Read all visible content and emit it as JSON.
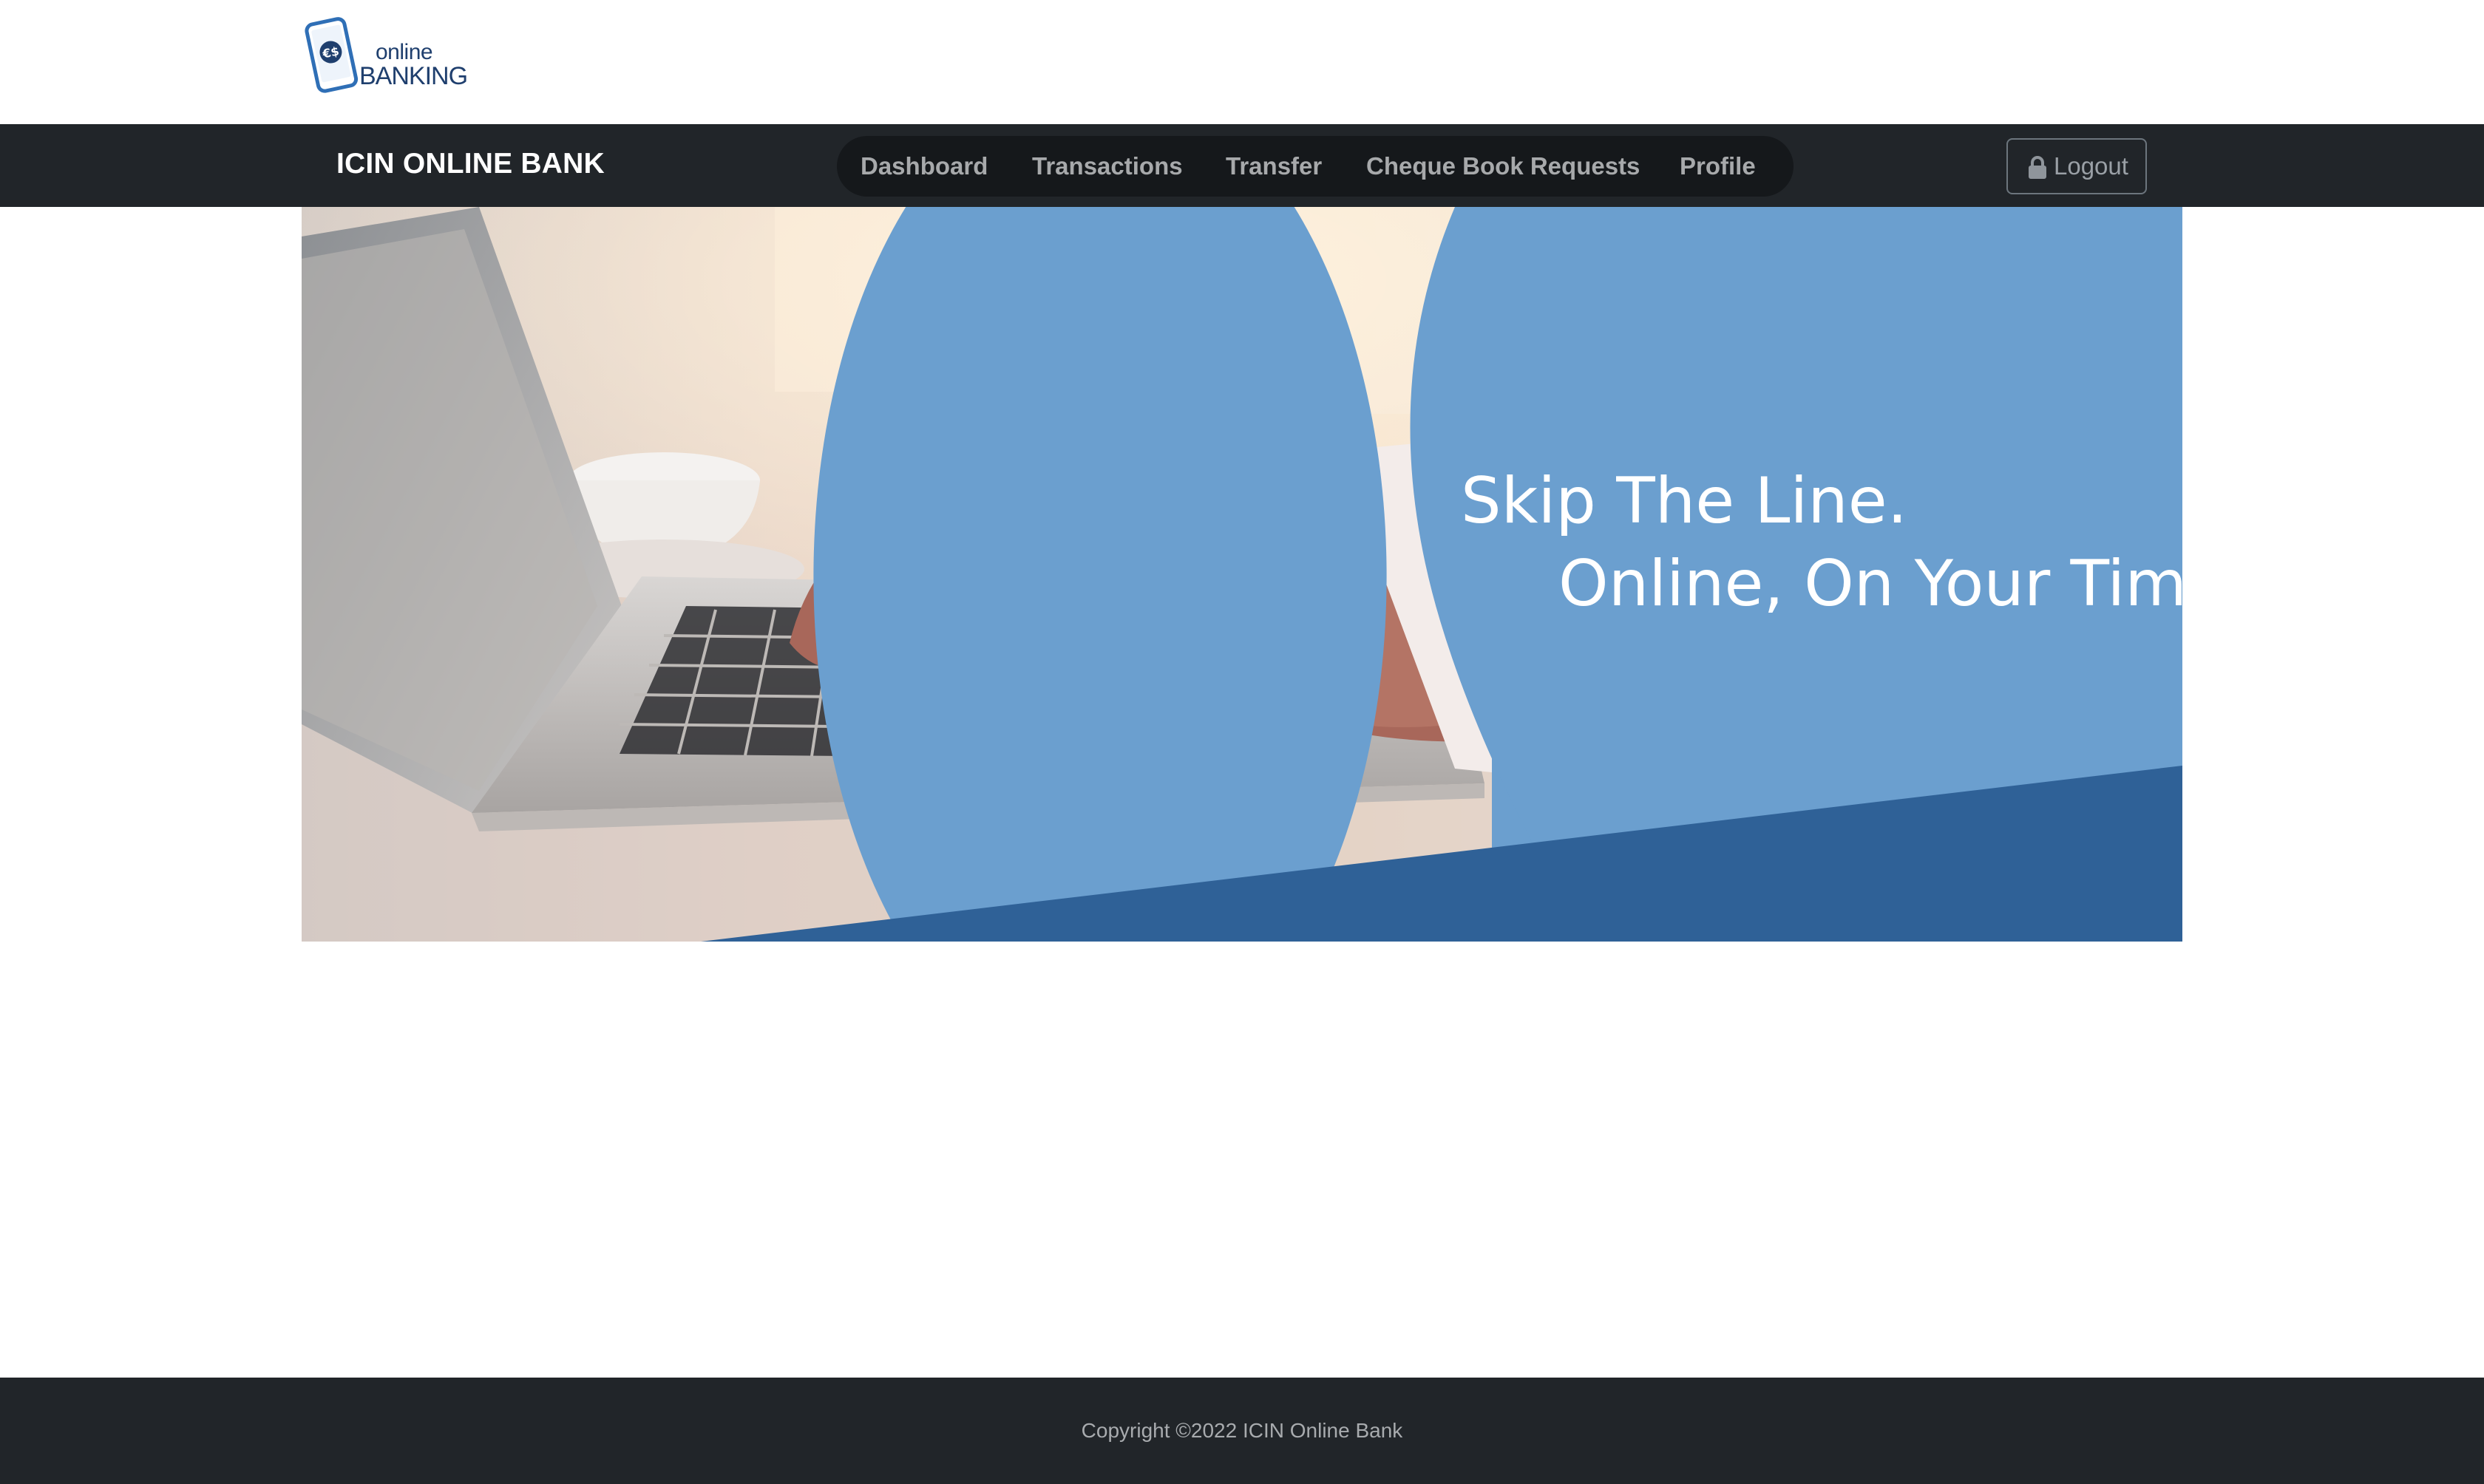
{
  "logo": {
    "icon": "phone-es-icon",
    "line1": "online",
    "line2": "BANKING"
  },
  "navbar": {
    "brand": "ICIN ONLINE BANK",
    "items": [
      {
        "label": "Dashboard"
      },
      {
        "label": "Transactions"
      },
      {
        "label": "Transfer"
      },
      {
        "label": "Cheque Book Requests"
      },
      {
        "label": "Profile"
      }
    ],
    "logout": {
      "label": "Logout",
      "icon": "lock-icon"
    }
  },
  "hero": {
    "line1": "Skip The Line.",
    "line2": "Online, On Your Time.",
    "colors": {
      "circle": "#6b9fcf",
      "band": "#2f6197"
    }
  },
  "footer": {
    "copyright": "Copyright ©2022 ICIN Online Bank"
  },
  "colors": {
    "navbar_bg": "#212529",
    "nav_pill_bg": "#15181b",
    "nav_text": "#a7a9ab",
    "brand_text": "#ffffff"
  }
}
